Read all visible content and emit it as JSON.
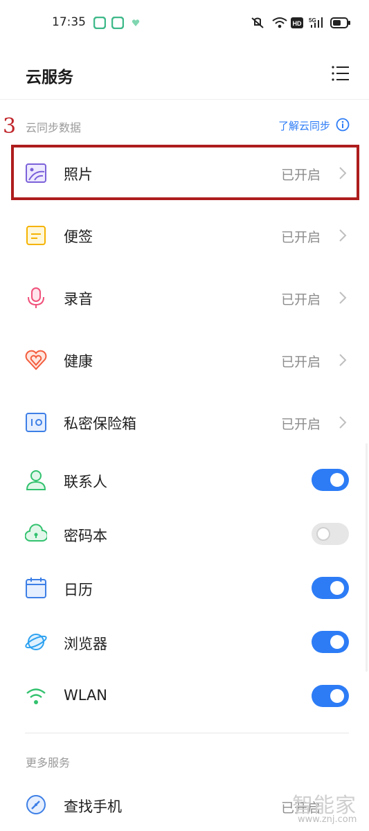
{
  "status_bar": {
    "time": "17:35",
    "icons": [
      "app-notification-icon",
      "app-notification-icon",
      "heart-small-icon",
      "mute-vibrate-icon",
      "wifi-icon",
      "hd-icon",
      "5g-signal-icon",
      "battery-icon"
    ]
  },
  "header": {
    "title": "云服务",
    "menu_icon": "list-menu-icon"
  },
  "sync_section": {
    "label": "云同步数据",
    "learn_more": "了解云同步",
    "annotation": "3",
    "items": [
      {
        "label": "照片",
        "status": "已开启",
        "icon": "photo-icon",
        "color": "#7b61d9"
      },
      {
        "label": "便签",
        "status": "已开启",
        "icon": "note-icon",
        "color": "#f5b300"
      },
      {
        "label": "录音",
        "status": "已开启",
        "icon": "microphone-icon",
        "color": "#f0507a"
      },
      {
        "label": "健康",
        "status": "已开启",
        "icon": "heart-icon",
        "color": "#f25c3c"
      },
      {
        "label": "私密保险箱",
        "status": "已开启",
        "icon": "safe-icon",
        "color": "#3d7fe6"
      }
    ],
    "toggles": [
      {
        "label": "联系人",
        "on": true,
        "icon": "contact-icon",
        "color": "#33c26f"
      },
      {
        "label": "密码本",
        "on": false,
        "icon": "cloud-lock-icon",
        "color": "#33c26f"
      },
      {
        "label": "日历",
        "on": true,
        "icon": "calendar-icon",
        "color": "#3d7fe6"
      },
      {
        "label": "浏览器",
        "on": true,
        "icon": "planet-icon",
        "color": "#2da1f0"
      },
      {
        "label": "WLAN",
        "on": true,
        "icon": "wlan-icon",
        "color": "#33c26f"
      }
    ]
  },
  "more_section": {
    "label": "更多服务",
    "items": [
      {
        "label": "查找手机",
        "status": "已开启",
        "icon": "compass-icon",
        "color": "#3d7fe6"
      }
    ]
  },
  "watermark": {
    "text": "智能家",
    "url": "www.znj.com"
  },
  "accent_color": "#2d7cf6"
}
